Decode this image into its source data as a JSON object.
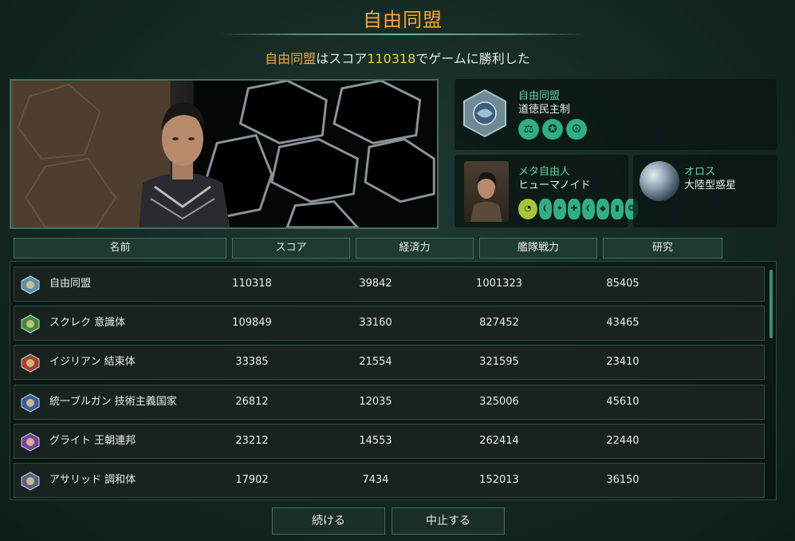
{
  "title": "自由同盟",
  "victory": {
    "empire": "自由同盟",
    "mid": "はスコア",
    "score": "110318",
    "tail": "でゲームに勝利した"
  },
  "empire_panel": {
    "name": "自由同盟",
    "government": "道徳民主制",
    "ethics_icons": [
      "scales-icon",
      "star-circle-icon",
      "peace-icon"
    ]
  },
  "species_panel": {
    "name": "メタ自由人",
    "type": "ヒューマノイド"
  },
  "planet_panel": {
    "name": "オロス",
    "type": "大陸型惑星"
  },
  "table": {
    "headers": [
      "名前",
      "スコア",
      "経済力",
      "艦隊戦力",
      "研究"
    ],
    "rows": [
      {
        "name": "自由同盟",
        "score": "110318",
        "economy": "39842",
        "fleet": "1001323",
        "research": "85405",
        "color": "#5b8fb0"
      },
      {
        "name": "スクレク 意識体",
        "score": "109849",
        "economy": "33160",
        "fleet": "827452",
        "research": "43465",
        "color": "#3f8a3a"
      },
      {
        "name": "イジリアン 結束体",
        "score": "33385",
        "economy": "21554",
        "fleet": "321595",
        "research": "23410",
        "color": "#a8402f"
      },
      {
        "name": "統一ブルガン 技術主義国家",
        "score": "26812",
        "economy": "12035",
        "fleet": "325006",
        "research": "45610",
        "color": "#3c5aa0"
      },
      {
        "name": "グライト 王朝連邦",
        "score": "23212",
        "economy": "14553",
        "fleet": "262414",
        "research": "22440",
        "color": "#7a3fa0"
      },
      {
        "name": "アサリッド 調和体",
        "score": "17902",
        "economy": "7434",
        "fleet": "152013",
        "research": "36150",
        "color": "#5a5f8a"
      }
    ]
  },
  "buttons": {
    "continue": "続ける",
    "quit": "中止する"
  }
}
